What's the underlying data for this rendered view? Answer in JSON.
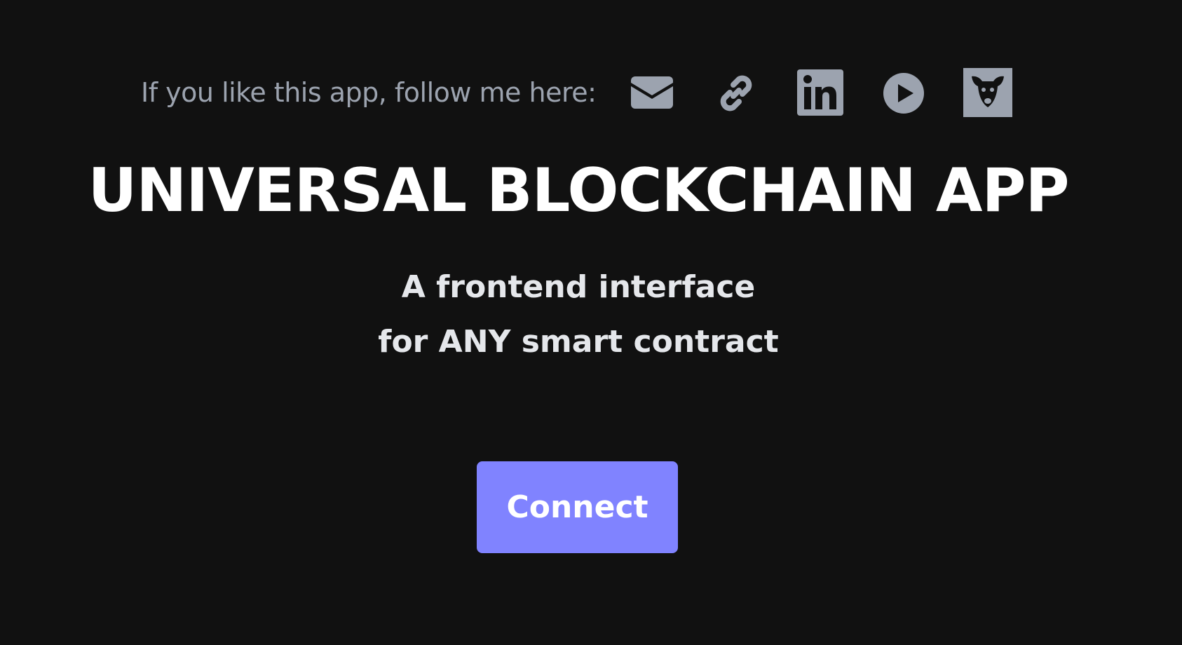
{
  "follow": {
    "text": "If you like this app, follow me here:",
    "icon_color": "#9ca3af",
    "icons": [
      "mail-icon",
      "link-icon",
      "linkedin-icon",
      "youtube-play-icon",
      "dog-logo-icon"
    ]
  },
  "header": {
    "title": "UNIVERSAL BLOCKCHAIN APP",
    "subtitle_line1": "A frontend interface",
    "subtitle_line2": "for ANY smart contract"
  },
  "actions": {
    "connect_label": "Connect"
  },
  "colors": {
    "background": "#111111",
    "accent": "#8083ff",
    "title": "#ffffff",
    "subtitle": "#e5e7eb",
    "muted": "#9ca3af"
  }
}
